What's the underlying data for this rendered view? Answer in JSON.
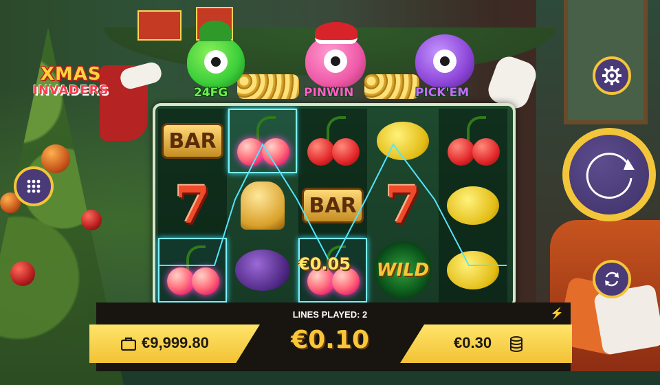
{
  "game": {
    "logo_line1": "XMAS",
    "logo_line2": "INVADERS"
  },
  "features": [
    {
      "label": "24FG",
      "color": "#3ccf3a",
      "label_color": "#6cf04a"
    },
    {
      "label": "PINWIN",
      "color": "#ef5aa8",
      "label_color": "#ff5fc7"
    },
    {
      "label": "PICK'EM",
      "color": "#8e47d9",
      "label_color": "#c46bff"
    }
  ],
  "reels": {
    "columns": [
      [
        "bar",
        "seven",
        "cherry"
      ],
      [
        "cherry",
        "bell",
        "plum"
      ],
      [
        "cherry",
        "bar",
        "cherry"
      ],
      [
        "lemon",
        "seven",
        "wild"
      ],
      [
        "cherry",
        "lemon",
        "lemon"
      ]
    ],
    "symbol_text": {
      "bar": "BAR",
      "seven": "7",
      "wild": "WILD"
    },
    "winning_cells": [
      [
        1,
        0
      ],
      [
        0,
        2
      ],
      [
        2,
        2
      ]
    ],
    "win_amount": "€0.05",
    "payline_color": "#52e6ff"
  },
  "controls": {
    "settings_icon": "gear-icon",
    "menu_icon": "grid-icon",
    "spin_icon": "spin-arrow-icon",
    "autoplay_icon": "autoplay-icon",
    "turbo_icon": "lightning-icon"
  },
  "footer": {
    "lines_played": "LINES PLAYED: 2",
    "balance": "€9,999.80",
    "balance_icon": "wallet-icon",
    "last_win": "€0.10",
    "total_bet": "€0.30",
    "bet_icon": "coins-icon"
  },
  "colors": {
    "accent_gold": "#f3c53a",
    "button_purple": "#4a3b78"
  }
}
